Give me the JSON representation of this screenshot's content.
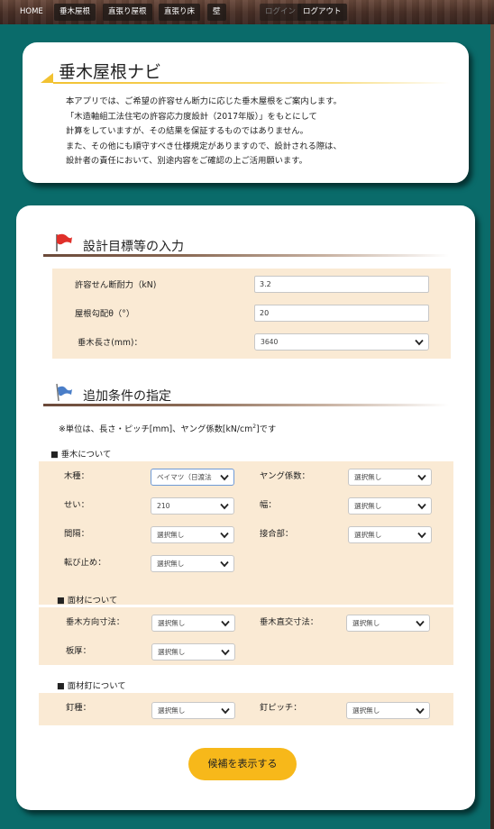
{
  "nav": {
    "items": [
      "HOME",
      "垂木屋根",
      "直張り屋根",
      "直張り床",
      "壁",
      "ログイン",
      "ログアウト"
    ]
  },
  "intro": {
    "title": "垂木屋根ナビ",
    "lines": [
      "本アプリでは、ご希望の許容せん断力に応じた垂木屋根をご案内します。",
      "「木造軸組工法住宅の許容応力度設計（2017年版）」をもとにして",
      "計算をしていますが、その結果を保証するものではありません。",
      "また、その他にも順守すべき仕様規定がありますので、設計される際は、",
      "設計者の責任において、別途内容をご確認の上ご活用願います。"
    ]
  },
  "design": {
    "heading": "設計目標等の入力",
    "shear_label": "許容せん断耐力（kN)",
    "shear_value": "3.2",
    "slope_label": "屋根勾配θ（°）",
    "slope_value": "20",
    "length_label": "垂木長さ(mm)：",
    "length_value": "3640"
  },
  "extra": {
    "heading": "追加条件の指定",
    "note_prefix": "※単位は、長さ・ピッチ[mm]、ヤング係数[kN/cm",
    "note_sup": "2",
    "note_suffix": "]です",
    "rafter": {
      "title": "■ 垂木について",
      "species_label": "木種：",
      "species_value": "ベイマツ（日渡法",
      "young_label": "ヤング係数：",
      "young_value": "選択無し",
      "height_label": "せい：",
      "height_value": "210",
      "width_label": "幅：",
      "width_value": "選択無し",
      "spacing_label": "間隔：",
      "spacing_value": "選択無し",
      "joint_label": "接合部：",
      "joint_value": "選択無し",
      "stop_label": "転び止め：",
      "stop_value": "選択無し"
    },
    "panel": {
      "title": "■ 面材について",
      "dir_label": "垂木方向寸法：",
      "dir_value": "選択無し",
      "cross_label": "垂木直交寸法：",
      "cross_value": "選択無し",
      "thick_label": "板厚：",
      "thick_value": "選択無し"
    },
    "nail": {
      "title": "■ 面材釘について",
      "type_label": "釘種：",
      "type_value": "選択無し",
      "pitch_label": "釘ピッチ：",
      "pitch_value": "選択無し"
    }
  },
  "submit_label": "候補を表示する",
  "colors": {
    "background": "#0a6b6a",
    "accent": "#f7b81a",
    "panel": "#faead4",
    "flag_red": "#e0302a",
    "flag_blue": "#4a7ec8"
  }
}
